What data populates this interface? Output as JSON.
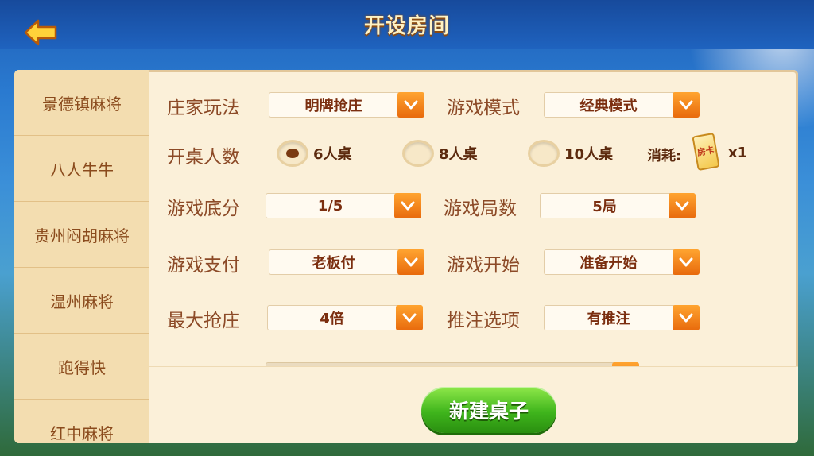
{
  "header": {
    "title": "开设房间"
  },
  "sidebar": {
    "items": [
      {
        "label": "景德镇麻将"
      },
      {
        "label": "八人牛牛"
      },
      {
        "label": "贵州闷胡麻将"
      },
      {
        "label": "温州麻将"
      },
      {
        "label": "跑得快"
      },
      {
        "label": "红中麻将"
      }
    ]
  },
  "form": {
    "banker_mode": {
      "label": "庄家玩法",
      "value": "明牌抢庄"
    },
    "game_mode": {
      "label": "游戏模式",
      "value": "经典模式"
    },
    "table_size": {
      "label": "开桌人数",
      "options": [
        {
          "label": "6人桌",
          "selected": true
        },
        {
          "label": "8人桌",
          "selected": false
        },
        {
          "label": "10人桌",
          "selected": false
        }
      ],
      "cost_label": "消耗:",
      "card_text": "房卡",
      "cost_count": "x1"
    },
    "base_score": {
      "label": "游戏底分",
      "value": "1/5"
    },
    "rounds": {
      "label": "游戏局数",
      "value": "5局"
    },
    "payment": {
      "label": "游戏支付",
      "value": "老板付"
    },
    "start": {
      "label": "游戏开始",
      "value": "准备开始"
    },
    "max_grab": {
      "label": "最大抢庄",
      "value": "4倍"
    },
    "push_bet": {
      "label": "推注选项",
      "value": "有推注"
    }
  },
  "actions": {
    "create_label": "新建桌子"
  },
  "colors": {
    "accent_orange": "#f08a1e",
    "button_green": "#3fb51c",
    "label_brown": "#8c4a27"
  }
}
